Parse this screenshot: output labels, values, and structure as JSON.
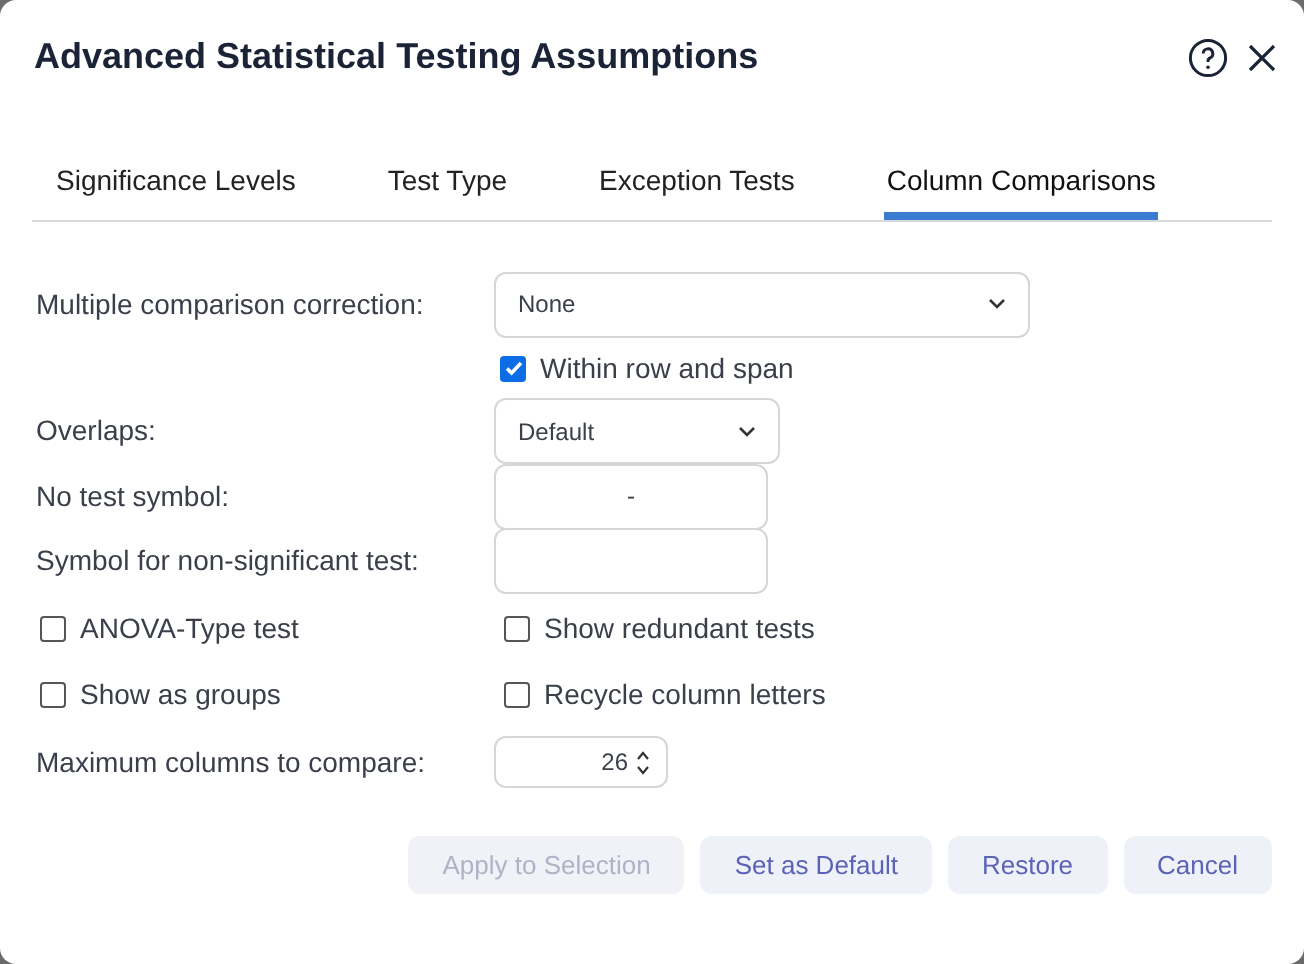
{
  "window": {
    "title": "Advanced Statistical Testing Assumptions"
  },
  "tabs": [
    {
      "label": "Significance Levels",
      "selected": false
    },
    {
      "label": "Test Type",
      "selected": false
    },
    {
      "label": "Exception Tests",
      "selected": false
    },
    {
      "label": "Column Comparisons",
      "selected": true
    }
  ],
  "correction": {
    "label": "Multiple comparison correction:",
    "value": "None"
  },
  "within": {
    "label": "Within row and span",
    "checked": true
  },
  "overlaps": {
    "label": "Overlaps:",
    "value": "Default"
  },
  "no_test_symbol": {
    "label": "No test symbol:",
    "value": "-"
  },
  "non_significant_symbol": {
    "label": "Symbol for non-significant test:"
  },
  "options": [
    {
      "label": "ANOVA-Type test",
      "checked": false
    },
    {
      "label": "Show redundant tests",
      "checked": false
    },
    {
      "label": "Show as groups",
      "checked": false
    },
    {
      "label": "Recycle column letters",
      "checked": false
    }
  ],
  "max_columns": {
    "label": "Maximum columns to compare:",
    "value": "26"
  },
  "buttons": [
    {
      "label": "Apply to Selection",
      "disabled": true
    },
    {
      "label": "Set as Default",
      "disabled": false
    },
    {
      "label": "Restore",
      "disabled": false
    },
    {
      "label": "Cancel",
      "disabled": false
    }
  ]
}
